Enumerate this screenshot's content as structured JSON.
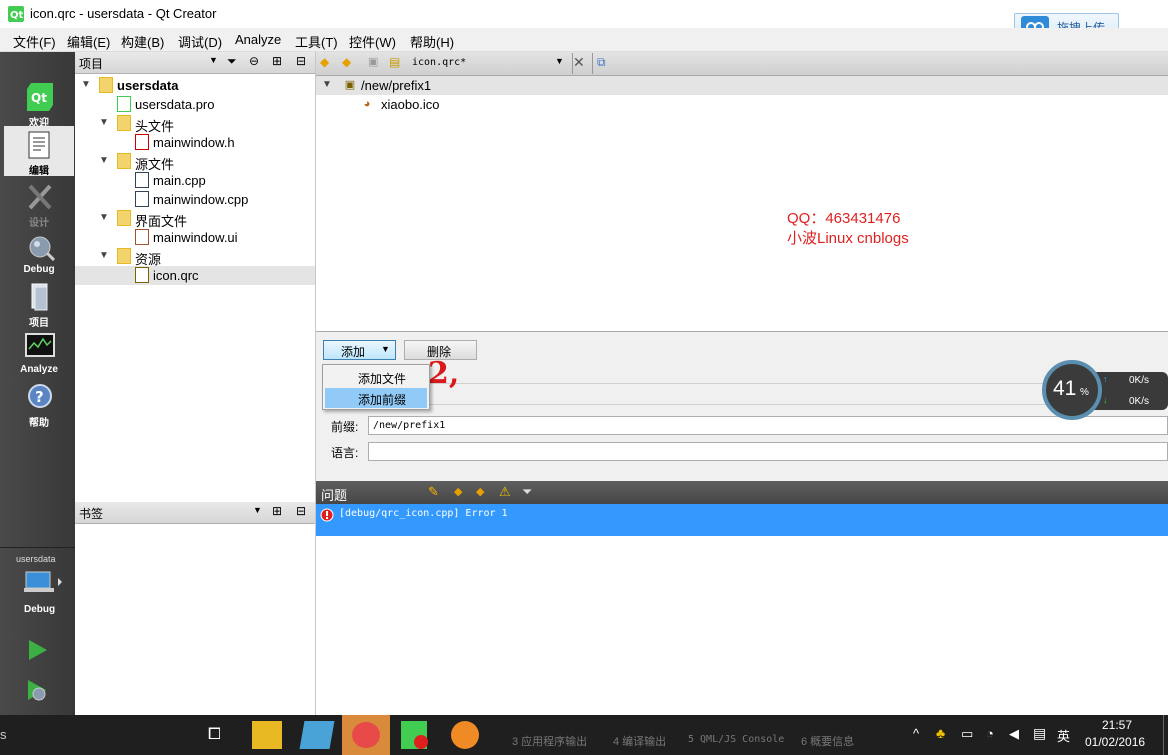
{
  "window": {
    "title": "icon.qrc - usersdata - Qt Creator",
    "upload_label": "拖拽上传"
  },
  "menu": [
    "文件(F)",
    "编辑(E)",
    "构建(B)",
    "调试(D)",
    "Analyze",
    "工具(T)",
    "控件(W)",
    "帮助(H)"
  ],
  "modes": [
    {
      "label": "欢迎",
      "icon": "qt-logo-icon"
    },
    {
      "label": "编辑",
      "icon": "edit-document-icon"
    },
    {
      "label": "设计",
      "icon": "design-tools-icon"
    },
    {
      "label": "Debug",
      "icon": "debug-bug-icon"
    },
    {
      "label": "项目",
      "icon": "project-icon"
    },
    {
      "label": "Analyze",
      "icon": "analyze-scope-icon"
    },
    {
      "label": "帮助",
      "icon": "help-icon"
    }
  ],
  "target": {
    "project": "usersdata",
    "config": "Debug"
  },
  "project_pane": {
    "header": "项目",
    "tree": [
      {
        "label": "usersdata",
        "level": 0,
        "bold": true,
        "expanded": true,
        "icon": "project-folder-icon"
      },
      {
        "label": "usersdata.pro",
        "level": 1,
        "icon": "pro-file-icon"
      },
      {
        "label": "头文件",
        "level": 1,
        "expanded": true,
        "icon": "header-folder-icon"
      },
      {
        "label": "mainwindow.h",
        "level": 2,
        "icon": "h-file-icon"
      },
      {
        "label": "源文件",
        "level": 1,
        "expanded": true,
        "icon": "source-folder-icon"
      },
      {
        "label": "main.cpp",
        "level": 2,
        "icon": "cpp-file-icon"
      },
      {
        "label": "mainwindow.cpp",
        "level": 2,
        "icon": "cpp-file-icon"
      },
      {
        "label": "界面文件",
        "level": 1,
        "expanded": true,
        "icon": "form-folder-icon"
      },
      {
        "label": "mainwindow.ui",
        "level": 2,
        "icon": "ui-file-icon"
      },
      {
        "label": "资源",
        "level": 1,
        "expanded": true,
        "icon": "resource-folder-icon"
      },
      {
        "label": "icon.qrc",
        "level": 2,
        "selected": true,
        "icon": "qrc-file-icon"
      }
    ]
  },
  "bookmarks_pane": {
    "header": "书签"
  },
  "editor": {
    "doc_name": "icon.qrc*",
    "res_tree": [
      {
        "label": "/new/prefix1",
        "level": 0
      },
      {
        "label": "xiaobo.ico",
        "level": 1
      }
    ],
    "watermark_line1": "QQ：463431476",
    "watermark_line2": "小波Linux cnblogs",
    "add_button": "添加",
    "delete_button": "删除",
    "popup_items": [
      "添加文件",
      "添加前缀"
    ],
    "annotation": "2,",
    "prefix_label": "前缀:",
    "prefix_value": "/new/prefix1",
    "lang_label": "语言:",
    "lang_value": ""
  },
  "issues": {
    "header": "问题",
    "row": "[debug/qrc_icon.cpp] Error 1"
  },
  "speed_widget": {
    "percent": "41",
    "unit": "%",
    "up": "0K/s",
    "down": "0K/s"
  },
  "taskbar": {
    "output_tabs": [
      "3 应用程序输出",
      "4 编译输出",
      "5 QML/JS Console",
      "6 概要信息"
    ],
    "ime": "英",
    "time": "21:57",
    "date": "01/02/2016",
    "left_char": "s"
  }
}
